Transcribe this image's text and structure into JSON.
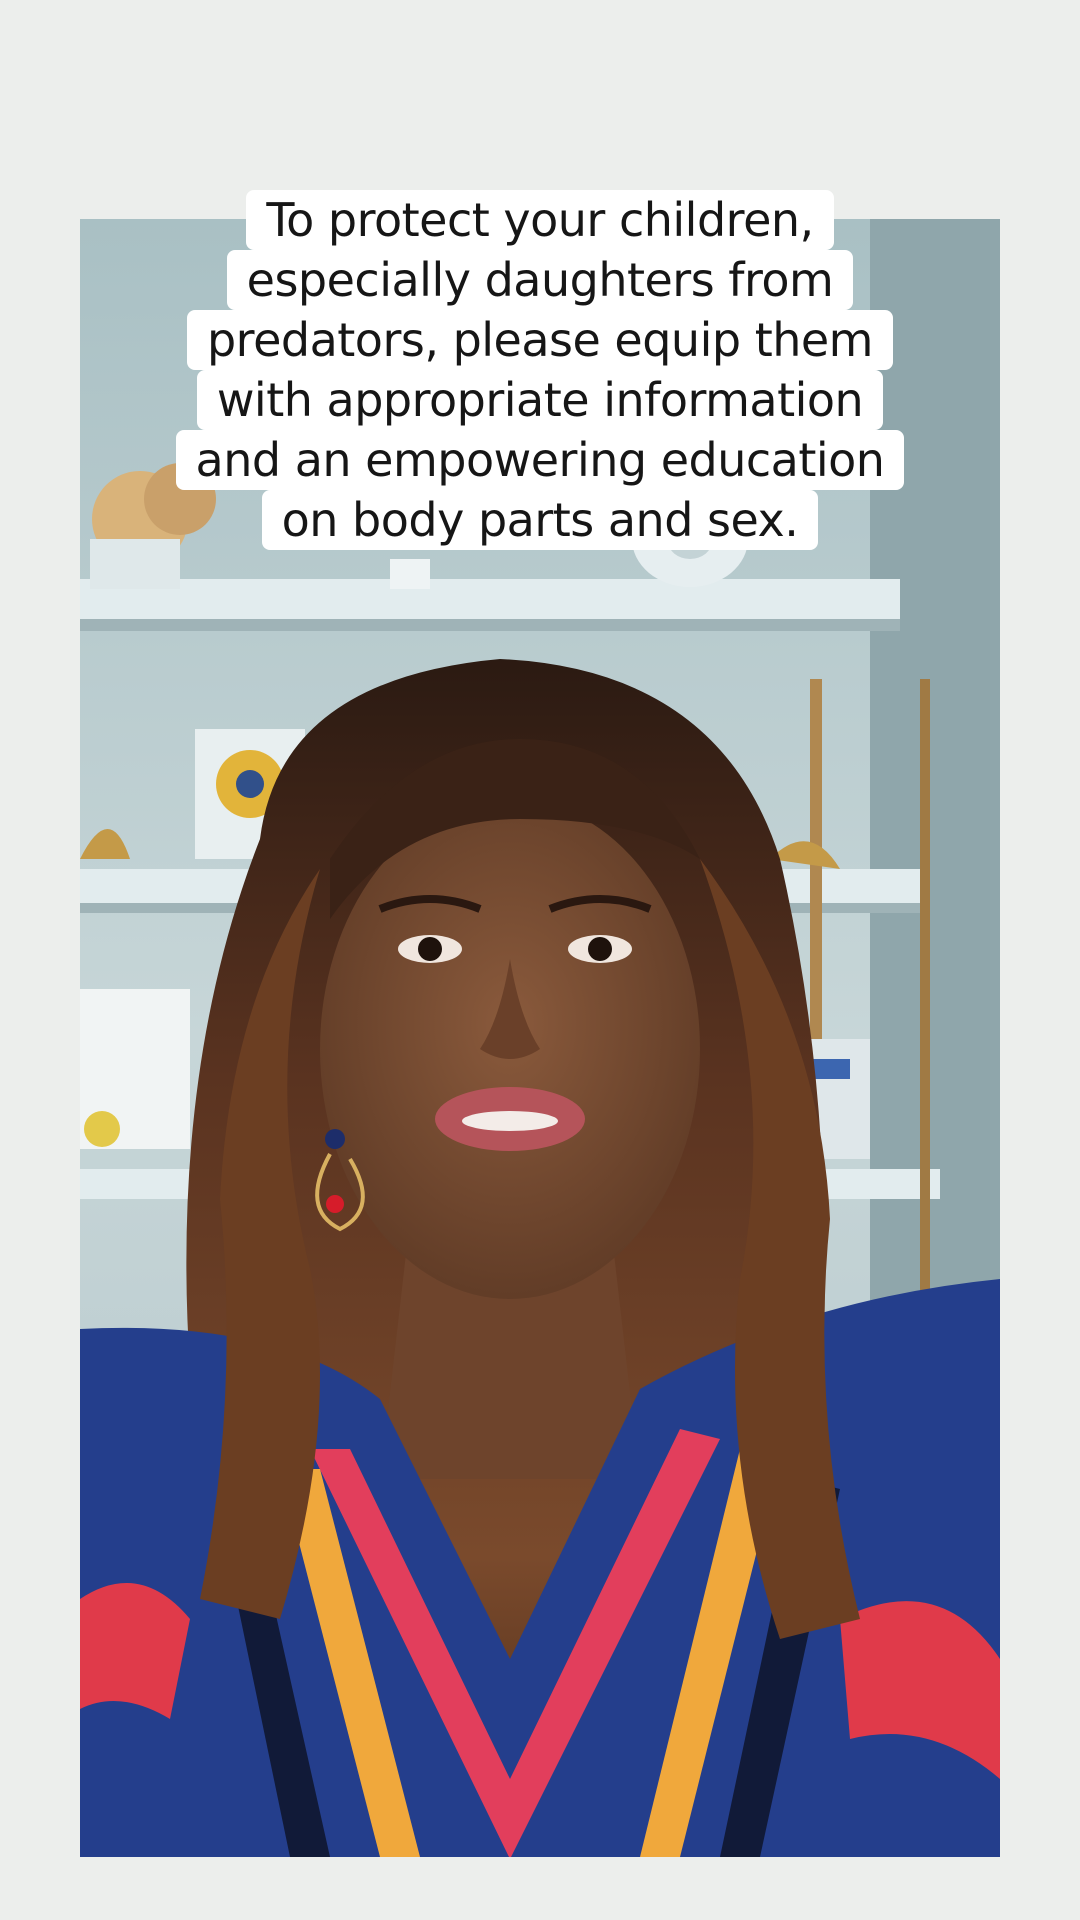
{
  "caption": {
    "lines": [
      "To protect your children,",
      "especially daughters from",
      "predators, please equip them",
      "with appropriate information",
      "and an empowering education",
      "on body parts and sex."
    ]
  },
  "video": {
    "subject": "woman-speaking-to-camera"
  },
  "colors": {
    "page_background": "#eceeec",
    "caption_background": "#ffffff",
    "caption_text": "#161616"
  }
}
